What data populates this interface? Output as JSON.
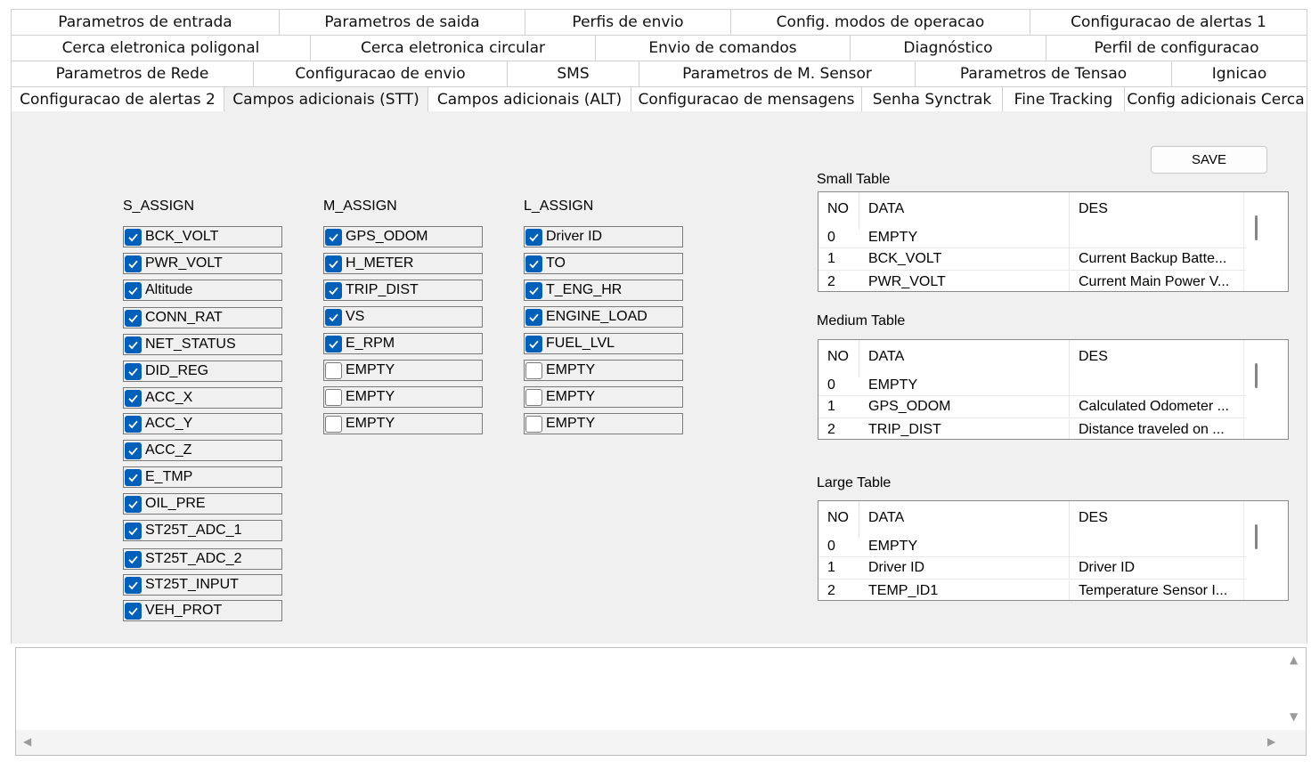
{
  "tabs": {
    "row1": [
      "Parametros de entrada",
      "Parametros de saida",
      "Perfis de envio",
      "Config. modos de operacao",
      "Configuracao de alertas 1"
    ],
    "row2": [
      "Cerca eletronica poligonal",
      "Cerca eletronica circular",
      "Envio de comandos",
      "Diagnóstico",
      "Perfil de configuracao"
    ],
    "row3": [
      "Parametros de Rede",
      "Configuracao de envio",
      "SMS",
      "Parametros de M. Sensor",
      "Parametros de Tensao",
      "Ignicao"
    ],
    "row4": [
      "Configuracao de alertas 2",
      "Campos adicionais (STT)",
      "Campos adicionais (ALT)",
      "Configuracao de mensagens",
      "Senha Synctrak",
      "Fine Tracking",
      "Config adicionais Cerca"
    ],
    "active": "Campos adicionais (STT)"
  },
  "columns": {
    "s_assign": {
      "title": "S_ASSIGN",
      "items": [
        {
          "label": "BCK_VOLT",
          "checked": true
        },
        {
          "label": "PWR_VOLT",
          "checked": true
        },
        {
          "label": "Altitude",
          "checked": true
        },
        {
          "label": "CONN_RAT",
          "checked": true
        },
        {
          "label": "NET_STATUS",
          "checked": true
        },
        {
          "label": "DID_REG",
          "checked": true
        },
        {
          "label": "ACC_X",
          "checked": true
        },
        {
          "label": "ACC_Y",
          "checked": true
        },
        {
          "label": "ACC_Z",
          "checked": true
        },
        {
          "label": "E_TMP",
          "checked": true
        },
        {
          "label": "OIL_PRE",
          "checked": true
        },
        {
          "label": "ST25T_ADC_1",
          "checked": true
        },
        {
          "label": "ST25T_ADC_2",
          "checked": true
        },
        {
          "label": "ST25T_INPUT",
          "checked": true
        },
        {
          "label": "VEH_PROT",
          "checked": true
        }
      ]
    },
    "m_assign": {
      "title": "M_ASSIGN",
      "items": [
        {
          "label": "GPS_ODOM",
          "checked": true
        },
        {
          "label": "H_METER",
          "checked": true
        },
        {
          "label": "TRIP_DIST",
          "checked": true
        },
        {
          "label": "VS",
          "checked": true
        },
        {
          "label": "E_RPM",
          "checked": true
        },
        {
          "label": "EMPTY",
          "checked": false
        },
        {
          "label": "EMPTY",
          "checked": false
        },
        {
          "label": "EMPTY",
          "checked": false
        }
      ]
    },
    "l_assign": {
      "title": "L_ASSIGN",
      "items": [
        {
          "label": "Driver ID",
          "checked": true
        },
        {
          "label": "TO",
          "checked": true
        },
        {
          "label": "T_ENG_HR",
          "checked": true
        },
        {
          "label": "ENGINE_LOAD",
          "checked": true
        },
        {
          "label": "FUEL_LVL",
          "checked": true
        },
        {
          "label": "EMPTY",
          "checked": false
        },
        {
          "label": "EMPTY",
          "checked": false
        },
        {
          "label": "EMPTY",
          "checked": false
        }
      ]
    }
  },
  "save_label": "SAVE",
  "tables": {
    "headers": [
      "NO",
      "DATA",
      "DES"
    ],
    "small": {
      "title": "Small Table",
      "rows": [
        [
          "0",
          "EMPTY",
          ""
        ],
        [
          "1",
          "BCK_VOLT",
          "Current Backup Batte..."
        ],
        [
          "2",
          "PWR_VOLT",
          "Current Main Power V..."
        ]
      ]
    },
    "medium": {
      "title": "Medium Table",
      "rows": [
        [
          "0",
          "EMPTY",
          ""
        ],
        [
          "1",
          "GPS_ODOM",
          "Calculated Odometer ..."
        ],
        [
          "2",
          "TRIP_DIST",
          "Distance traveled on ..."
        ]
      ]
    },
    "large": {
      "title": "Large Table",
      "rows": [
        [
          "0",
          "EMPTY",
          ""
        ],
        [
          "1",
          "Driver ID",
          "Driver ID"
        ],
        [
          "2",
          "TEMP_ID1",
          "Temperature Sensor I..."
        ]
      ]
    }
  },
  "log": {
    "text": ""
  }
}
